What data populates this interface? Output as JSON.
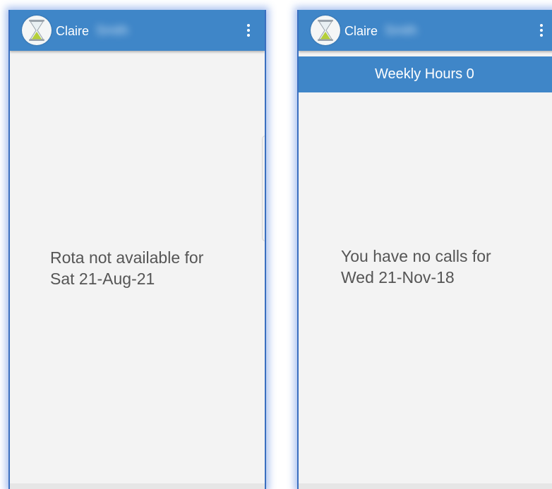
{
  "left_screen": {
    "header": {
      "user_first_name": "Claire",
      "user_last_name": "Smith"
    },
    "empty_state": {
      "line1": "Rota not available for",
      "line2": "Sat 21-Aug-21"
    }
  },
  "right_screen": {
    "header": {
      "user_first_name": "Claire",
      "user_last_name": "Smith"
    },
    "banner": {
      "weekly_hours": "Weekly Hours 0"
    },
    "empty_state": {
      "line1": "You have no calls for",
      "line2": "Wed 21-Nov-18"
    }
  },
  "icons": {
    "logo": "hourglass-icon",
    "menu": "more-vert-icon"
  },
  "colors": {
    "app_bar": "#3f86c8",
    "background": "#f3f3f3",
    "message_text": "#555555",
    "frame_glow": "#3a6fc0"
  }
}
